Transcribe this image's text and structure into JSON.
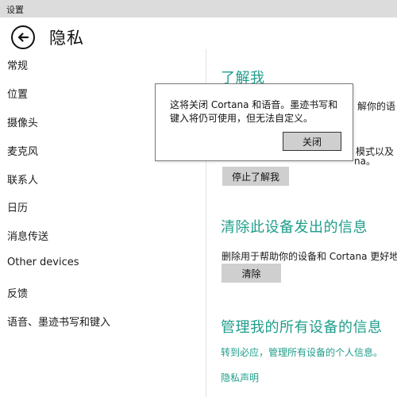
{
  "window": {
    "title": "设置"
  },
  "header": {
    "title": "隐私"
  },
  "sidebar": {
    "items": [
      {
        "label": "常规"
      },
      {
        "label": "位置"
      },
      {
        "label": "摄像头"
      },
      {
        "label": "麦克风"
      },
      {
        "label": "联系人"
      },
      {
        "label": "日历"
      },
      {
        "label": "消息传送"
      },
      {
        "label": "Other devices"
      },
      {
        "label": "反馈"
      },
      {
        "label": "语音、墨迹书写和键入"
      }
    ]
  },
  "content": {
    "get_to_know": {
      "heading": "了解我",
      "line1_fragment": "解你的语",
      "line2_fragment": "模式以及",
      "line3_fragment": "na。",
      "button_label": "停止了解我"
    },
    "clear_device": {
      "heading": "清除此设备发出的信息",
      "description": "删除用于帮助你的设备和 Cortana 更好地",
      "button_label": "清除"
    },
    "manage_all": {
      "heading": "管理我的所有设备的信息",
      "link_text": "转到必应，管理所有设备的个人信息。",
      "privacy_link": "隐私声明"
    }
  },
  "dialog": {
    "line1": "这将关闭 Cortana 和语音。墨迹书写和",
    "line2": "键入将仍可使用，但无法自定义。",
    "close_label": "关闭"
  },
  "colors": {
    "accent": "#1f9d8a",
    "titlebar": "#dcdcdc",
    "button": "#cfcfcf"
  }
}
